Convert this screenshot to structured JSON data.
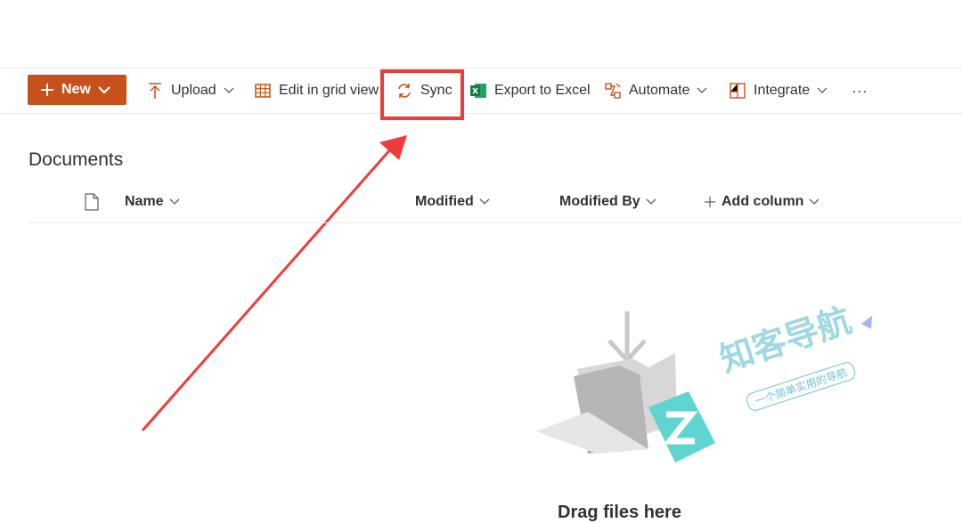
{
  "toolbar": {
    "new_label": "New",
    "upload_label": "Upload",
    "edit_grid_label": "Edit in grid view",
    "sync_label": "Sync",
    "export_label": "Export to Excel",
    "automate_label": "Automate",
    "integrate_label": "Integrate",
    "more_label": "···"
  },
  "library": {
    "title": "Documents",
    "columns": {
      "name": "Name",
      "modified": "Modified",
      "modified_by": "Modified By",
      "add_column": "Add column"
    }
  },
  "empty_state": {
    "message": "Drag files here"
  },
  "watermark": {
    "title": "知客导航",
    "subtitle": "一个简单实用的导航"
  },
  "colors": {
    "accent": "#c7511a",
    "annotation_red": "#ef3b3b",
    "watermark_teal": "#5fd4d0"
  },
  "icons": {
    "new": "plus-icon",
    "upload": "upload-arrow-icon",
    "edit_grid": "grid-icon",
    "sync": "sync-icon",
    "export": "excel-icon",
    "automate": "flow-icon",
    "integrate": "integrate-icon",
    "more": "more-icon",
    "document": "document-icon"
  }
}
